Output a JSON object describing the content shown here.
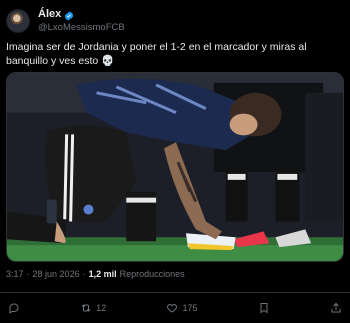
{
  "author": {
    "display_name": "Álex",
    "handle": "@LxoMessismoFCB",
    "verified": true
  },
  "tweet": {
    "text": "Imagina ser de Jordania y poner el 1-2 en el marcador y miras al banquillo y ves esto 💀"
  },
  "media": {
    "description_icon": "photo"
  },
  "meta": {
    "time": "3:17",
    "date": "28 jun 2026",
    "views_count": "1,2 mil",
    "views_label": "Reproducciones"
  },
  "actions": {
    "reply_count": "",
    "retweet_count": "12",
    "like_count": "175",
    "bookmark_count": ""
  },
  "colors": {
    "background": "#000000",
    "text": "#e7e9ea",
    "secondary": "#71767b",
    "verified": "#1d9bf0",
    "divider": "#2f3336"
  }
}
